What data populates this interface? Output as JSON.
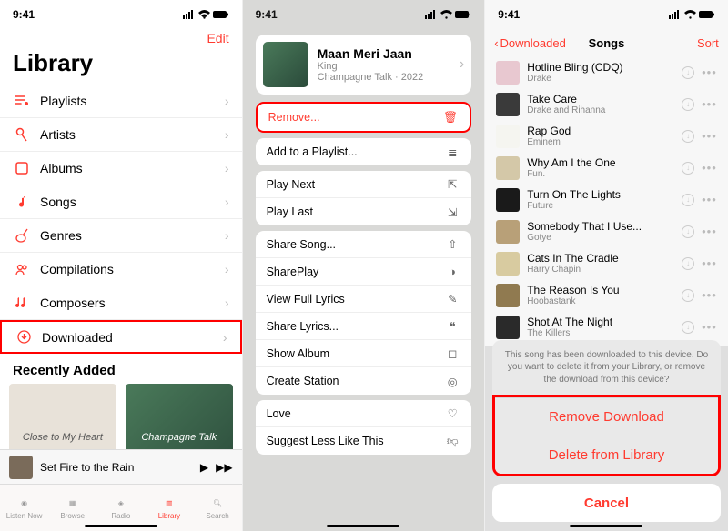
{
  "status": {
    "time": "9:41"
  },
  "p1": {
    "edit": "Edit",
    "title": "Library",
    "rows": [
      {
        "label": "Playlists"
      },
      {
        "label": "Artists"
      },
      {
        "label": "Albums"
      },
      {
        "label": "Songs"
      },
      {
        "label": "Genres"
      },
      {
        "label": "Compilations"
      },
      {
        "label": "Composers"
      },
      {
        "label": "Downloaded"
      }
    ],
    "recently": "Recently Added",
    "recentAlbums": [
      "Close to My Heart",
      "Champagne Talk"
    ],
    "nowplaying": "Set Fire to the Rain",
    "tabs": [
      "Listen Now",
      "Browse",
      "Radio",
      "Library",
      "Search"
    ]
  },
  "p2": {
    "song": {
      "title": "Maan Meri Jaan",
      "artist": "King",
      "album": "Champagne Talk · 2022"
    },
    "groups": [
      [
        "Remove..."
      ],
      [
        "Add to a Playlist..."
      ],
      [
        "Play Next",
        "Play Last"
      ],
      [
        "Share Song...",
        "SharePlay",
        "View Full Lyrics",
        "Share Lyrics...",
        "Show Album",
        "Create Station"
      ],
      [
        "Love",
        "Suggest Less Like This"
      ]
    ]
  },
  "p3": {
    "back": "Downloaded",
    "title": "Songs",
    "sort": "Sort",
    "songs": [
      {
        "title": "Hotline Bling (CDQ)",
        "artist": "Drake",
        "art": "#e8c8d0"
      },
      {
        "title": "Take Care",
        "artist": "Drake and Rihanna",
        "art": "#3a3a3a"
      },
      {
        "title": "Rap God",
        "artist": "Eminem",
        "art": "#f5f5f0"
      },
      {
        "title": "Why Am I the One",
        "artist": "Fun.",
        "art": "#d4c8a8"
      },
      {
        "title": "Turn On The Lights",
        "artist": "Future",
        "art": "#1a1a1a"
      },
      {
        "title": "Somebody That I Use...",
        "artist": "Gotye",
        "art": "#b8a078"
      },
      {
        "title": "Cats In The Cradle",
        "artist": "Harry Chapin",
        "art": "#d8cba0"
      },
      {
        "title": "The Reason Is You",
        "artist": "Hoobastank",
        "art": "#907a50"
      },
      {
        "title": "Shot At The Night",
        "artist": "The Killers",
        "art": "#2a2a2a"
      }
    ],
    "sheet": {
      "message": "This song has been downloaded to this device. Do you want to delete it from your Library, or remove the download from this device?",
      "actions": [
        "Remove Download",
        "Delete from Library"
      ],
      "cancel": "Cancel"
    }
  }
}
